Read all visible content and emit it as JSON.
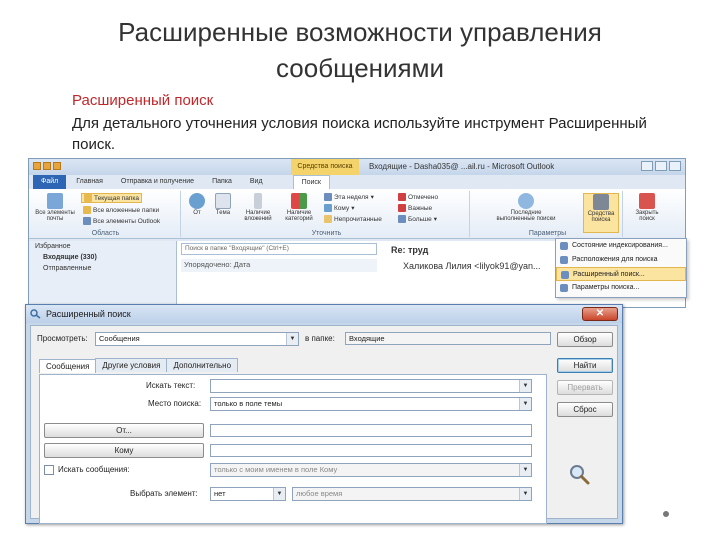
{
  "slide": {
    "title": "Расширенные возможности управления сообщениями",
    "subtitle": "Расширенный поиск",
    "body": "Для детального уточнения условия поиска используйте инструмент Расширенный поиск."
  },
  "outlook": {
    "context_tab": "Средства поиска",
    "window_title": "Входящие - Dasha035@ ...ail.ru - Microsoft Outlook",
    "tabs": [
      "Файл",
      "Главная",
      "Отправка и получение",
      "Папка",
      "Вид",
      "Поиск"
    ],
    "ribbon": {
      "scope": {
        "all_items": "Все элементы почты",
        "current_folder": "Текущая папка",
        "subfolders": "Все вложенные папки",
        "all_outlook": "Все элементы Outlook",
        "group_label": "Область"
      },
      "refine": {
        "from": "От",
        "subject": "Тема",
        "has_attachments": "Наличие вложений",
        "categorized": "Наличие категорий",
        "this_week": "Эта неделя",
        "sent_to": "Кому",
        "unread": "Непрочитанные",
        "flagged": "Отмечено",
        "important": "Важные",
        "more": "Больше",
        "group_label": "Уточнить"
      },
      "options": {
        "recent_searches": "Последние выполненные поиски",
        "search_tools": "Средства поиска",
        "group_label": "Параметры"
      },
      "close": {
        "label": "Закрыть поиск"
      }
    },
    "dropdown": [
      "Состояние индексирования...",
      "Расположения для поиска",
      "Расширенный поиск...",
      "Параметры поиска..."
    ],
    "nav": [
      "Избранное",
      "Входящие (330)",
      "Отправленные"
    ],
    "search_placeholder": "Поиск в папке \"Входящие\" (Ctrl+E)",
    "list_row": "Упорядочено: Дата",
    "reading": {
      "subject": "Re: труд",
      "from": "Халикова Лилия <lilyok91@yan..."
    }
  },
  "dialog": {
    "title": "Расширенный поиск",
    "view_label": "Просмотреть:",
    "view_value": "Сообщения",
    "folder_label": "в папке:",
    "folder_value": "Входящие",
    "tabs": [
      "Сообщения",
      "Другие условия",
      "Дополнительно"
    ],
    "search_text_label": "Искать текст:",
    "search_text_value": "",
    "where_label": "Место поиска:",
    "where_value": "только в поле темы",
    "from_button": "От...",
    "to_button": "Кому",
    "where_i_am_label": "Искать сообщения:",
    "where_i_am_value": "только с моим именем в поле Кому",
    "time_label": "Выбрать элемент:",
    "time_value": "нет",
    "time_value2": "любое время",
    "buttons": {
      "browse": "Обзор",
      "find": "Найти",
      "stop": "Прервать",
      "new_search": "Сброс"
    },
    "close": "✕"
  }
}
